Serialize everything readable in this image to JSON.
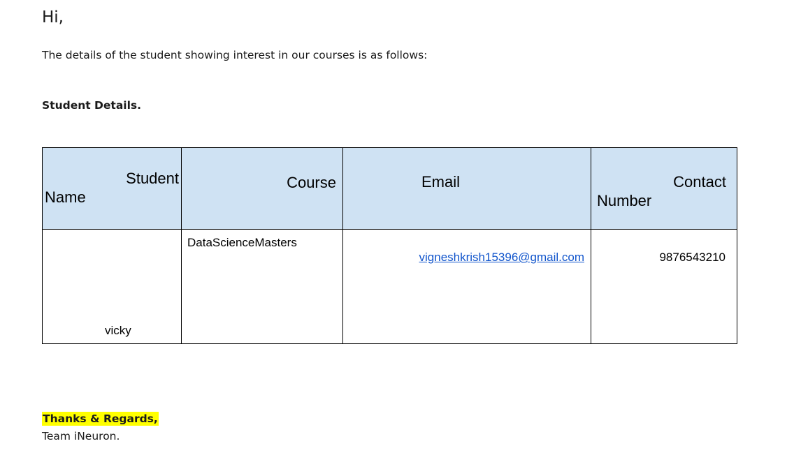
{
  "email": {
    "greeting": "Hi,",
    "intro": "The details of the student showing interest in our courses is as follows:",
    "section_title": "Student Details.",
    "table": {
      "headers": {
        "student_name_line1": "Student",
        "student_name_line2": "Name",
        "course": "Course",
        "email": "Email",
        "contact_line1": "Contact",
        "contact_line2": "Number"
      },
      "row": {
        "name": "vicky",
        "course": "DataScienceMasters",
        "email": "vigneshkrish15396@gmail.com",
        "contact": "9876543210"
      }
    },
    "regards": "Thanks & Regards,",
    "signature": "Team iNeuron."
  },
  "colors": {
    "header_bg": "#cfe2f3",
    "link": "#1155cc",
    "highlight": "#ffff00"
  }
}
